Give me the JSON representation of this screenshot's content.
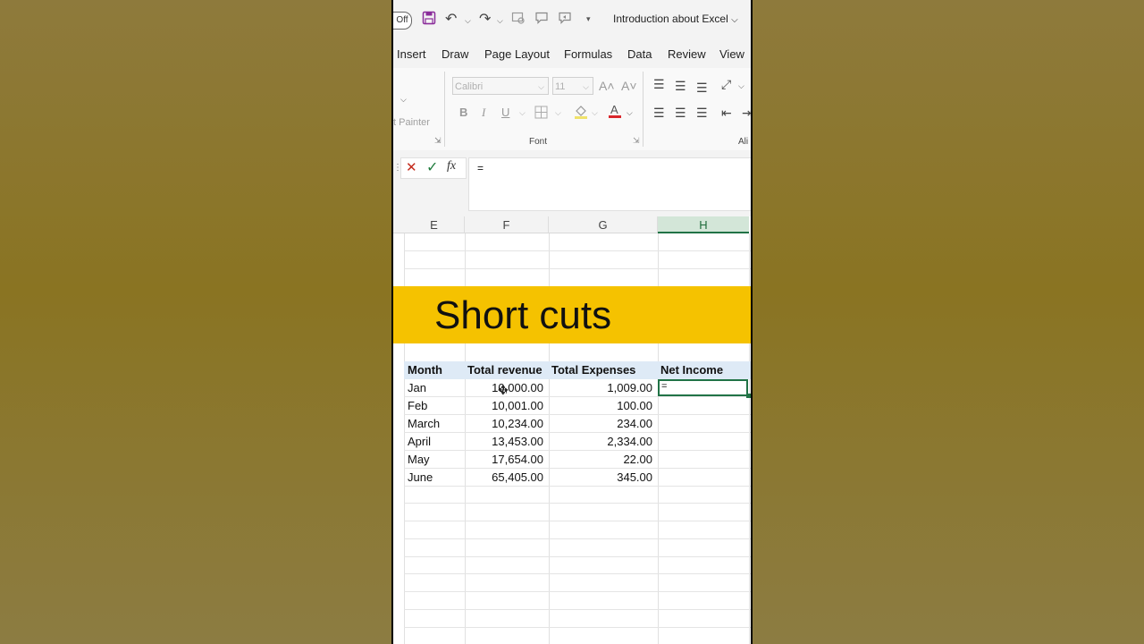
{
  "quick_access": {
    "autosave_toggle": "Off",
    "document_title": "Introduction about Excel"
  },
  "ribbon_tabs": [
    "Insert",
    "Draw",
    "Page Layout",
    "Formulas",
    "Data",
    "Review",
    "View"
  ],
  "ribbon": {
    "format_painter_label": "t Painter",
    "font_name": "Calibri",
    "font_size": "11",
    "bold": "B",
    "italic": "I",
    "underline": "U",
    "font_group_label": "Font",
    "alignment_group_label": "Ali",
    "increase_font_glyph": "A˄",
    "decrease_font_glyph": "A˅"
  },
  "formula_bar": {
    "cancel_glyph": "✕",
    "enter_glyph": "✓",
    "fx_label": "fx",
    "content": "="
  },
  "columns": [
    {
      "letter": "E",
      "active": false
    },
    {
      "letter": "F",
      "active": false
    },
    {
      "letter": "G",
      "active": false
    },
    {
      "letter": "H",
      "active": true
    }
  ],
  "banner": {
    "text": "Short cuts",
    "color": "#f5c200"
  },
  "table": {
    "headers": [
      "Month",
      "Total revenue",
      "Total Expenses",
      "Net Income"
    ],
    "rows": [
      {
        "month": "Jan",
        "revenue": "10,000.00",
        "expenses": "1,009.00",
        "net": "="
      },
      {
        "month": "Feb",
        "revenue": "10,001.00",
        "expenses": "100.00",
        "net": ""
      },
      {
        "month": "March",
        "revenue": "10,234.00",
        "expenses": "234.00",
        "net": ""
      },
      {
        "month": "April",
        "revenue": "13,453.00",
        "expenses": "2,334.00",
        "net": ""
      },
      {
        "month": "May",
        "revenue": "17,654.00",
        "expenses": "22.00",
        "net": ""
      },
      {
        "month": "June",
        "revenue": "65,405.00",
        "expenses": "345.00",
        "net": ""
      }
    ]
  },
  "colors": {
    "accent_green": "#217346",
    "header_fill": "#deeaf6",
    "save_purple": "#8a2c9a"
  }
}
